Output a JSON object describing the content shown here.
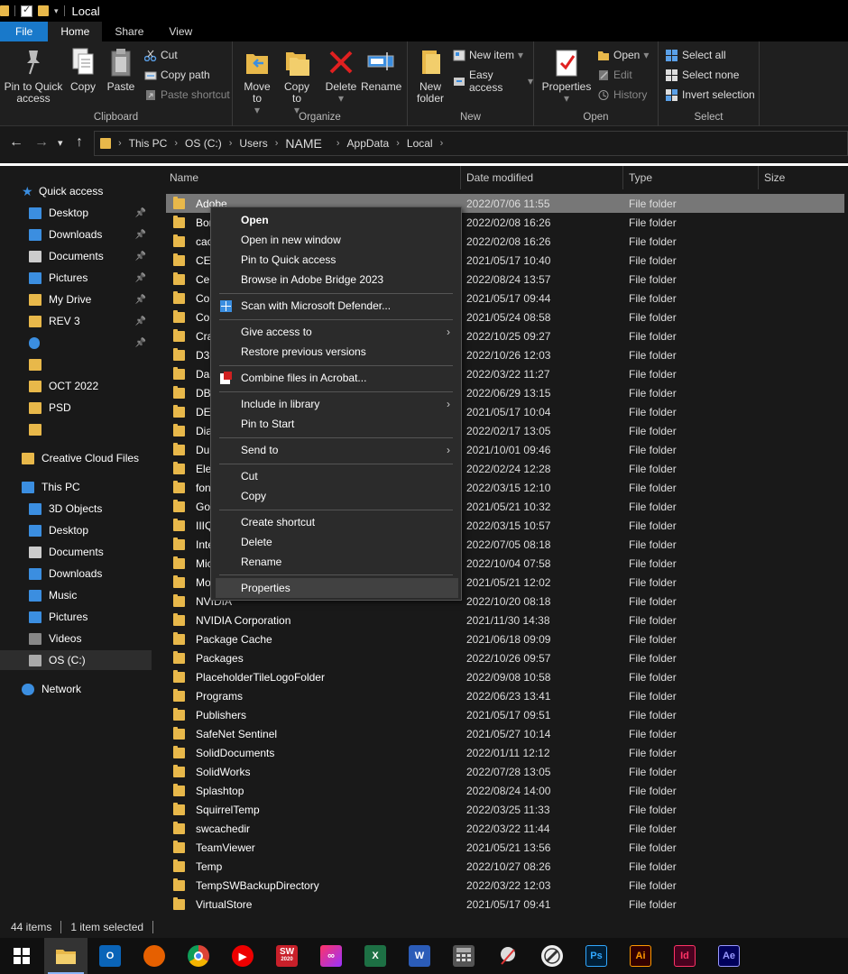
{
  "window": {
    "title": "Local"
  },
  "ribbon": {
    "tabs": [
      "File",
      "Home",
      "Share",
      "View"
    ],
    "clipboard": {
      "label": "Clipboard",
      "pin": "Pin to Quick access",
      "copy": "Copy",
      "paste": "Paste",
      "cut": "Cut",
      "copy_path": "Copy path",
      "paste_shortcut": "Paste shortcut"
    },
    "organize": {
      "label": "Organize",
      "move_to": "Move to",
      "copy_to": "Copy to",
      "delete": "Delete",
      "rename": "Rename"
    },
    "new": {
      "label": "New",
      "new_folder": "New folder",
      "new_item": "New item",
      "easy_access": "Easy access"
    },
    "open": {
      "label": "Open",
      "properties": "Properties",
      "open": "Open",
      "edit": "Edit",
      "history": "History"
    },
    "select": {
      "label": "Select",
      "select_all": "Select all",
      "select_none": "Select none",
      "invert": "Invert selection"
    }
  },
  "address": {
    "crumbs": [
      "This PC",
      "OS (C:)",
      "Users",
      "NAME",
      "AppData",
      "Local"
    ]
  },
  "nav": {
    "quick_access": "Quick access",
    "qa_items": [
      "Desktop",
      "Downloads",
      "Documents",
      "Pictures",
      "My Drive",
      "REV 3",
      "",
      "",
      "OCT 2022",
      "PSD",
      ""
    ],
    "creative_cloud": "Creative Cloud Files",
    "this_pc": "This PC",
    "pc_items": [
      "3D Objects",
      "Desktop",
      "Documents",
      "Downloads",
      "Music",
      "Pictures",
      "Videos",
      "OS (C:)"
    ],
    "network": "Network"
  },
  "columns": {
    "name": "Name",
    "date": "Date modified",
    "type": "Type",
    "size": "Size"
  },
  "files": [
    {
      "name": "Adobe",
      "date": "2022/07/06 11:55",
      "type": "File folder"
    },
    {
      "name": "Boris",
      "date": "2022/02/08 16:26",
      "type": "File folder"
    },
    {
      "name": "cach",
      "date": "2022/02/08 16:26",
      "type": "File folder"
    },
    {
      "name": "CEF",
      "date": "2021/05/17 10:40",
      "type": "File folder"
    },
    {
      "name": "Cent",
      "date": "2022/08/24 13:57",
      "type": "File folder"
    },
    {
      "name": "Com",
      "date": "2021/05/17 09:44",
      "type": "File folder"
    },
    {
      "name": "Con",
      "date": "2021/05/24 08:58",
      "type": "File folder"
    },
    {
      "name": "Cras",
      "date": "2022/10/25 09:27",
      "type": "File folder"
    },
    {
      "name": "D3D",
      "date": "2022/10/26 12:03",
      "type": "File folder"
    },
    {
      "name": "Dass",
      "date": "2022/03/22 11:27",
      "type": "File folder"
    },
    {
      "name": "DBG",
      "date": "2022/06/29 13:15",
      "type": "File folder"
    },
    {
      "name": "DELL",
      "date": "2021/05/17 10:04",
      "type": "File folder"
    },
    {
      "name": "Diag",
      "date": "2022/02/17 13:05",
      "type": "File folder"
    },
    {
      "name": "Dup",
      "date": "2021/10/01 09:46",
      "type": "File folder"
    },
    {
      "name": "Eleva",
      "date": "2022/02/24 12:28",
      "type": "File folder"
    },
    {
      "name": "font",
      "date": "2022/03/15 12:10",
      "type": "File folder"
    },
    {
      "name": "Goo",
      "date": "2021/05/21 10:32",
      "type": "File folder"
    },
    {
      "name": "IIIQF",
      "date": "2022/03/15 10:57",
      "type": "File folder"
    },
    {
      "name": "Intel",
      "date": "2022/07/05 08:18",
      "type": "File folder"
    },
    {
      "name": "Micr",
      "date": "2022/10/04 07:58",
      "type": "File folder"
    },
    {
      "name": "Moz",
      "date": "2021/05/21 12:02",
      "type": "File folder"
    },
    {
      "name": "NVIDIA",
      "date": "2022/10/20 08:18",
      "type": "File folder"
    },
    {
      "name": "NVIDIA Corporation",
      "date": "2021/11/30 14:38",
      "type": "File folder"
    },
    {
      "name": "Package Cache",
      "date": "2021/06/18 09:09",
      "type": "File folder"
    },
    {
      "name": "Packages",
      "date": "2022/10/26 09:57",
      "type": "File folder"
    },
    {
      "name": "PlaceholderTileLogoFolder",
      "date": "2022/09/08 10:58",
      "type": "File folder"
    },
    {
      "name": "Programs",
      "date": "2022/06/23 13:41",
      "type": "File folder"
    },
    {
      "name": "Publishers",
      "date": "2021/05/17 09:51",
      "type": "File folder"
    },
    {
      "name": "SafeNet Sentinel",
      "date": "2021/05/27 10:14",
      "type": "File folder"
    },
    {
      "name": "SolidDocuments",
      "date": "2022/01/11 12:12",
      "type": "File folder"
    },
    {
      "name": "SolidWorks",
      "date": "2022/07/28 13:05",
      "type": "File folder"
    },
    {
      "name": "Splashtop",
      "date": "2022/08/24 14:00",
      "type": "File folder"
    },
    {
      "name": "SquirrelTemp",
      "date": "2022/03/25 11:33",
      "type": "File folder"
    },
    {
      "name": "swcachedir",
      "date": "2022/03/22 11:44",
      "type": "File folder"
    },
    {
      "name": "TeamViewer",
      "date": "2021/05/21 13:56",
      "type": "File folder"
    },
    {
      "name": "Temp",
      "date": "2022/10/27 08:26",
      "type": "File folder"
    },
    {
      "name": "TempSWBackupDirectory",
      "date": "2022/03/22 12:03",
      "type": "File folder"
    },
    {
      "name": "VirtualStore",
      "date": "2021/05/17 09:41",
      "type": "File folder"
    }
  ],
  "context_menu": {
    "items": [
      "Open",
      "Open in new window",
      "Pin to Quick access",
      "Browse in Adobe Bridge 2023",
      "Scan with Microsoft Defender...",
      "Give access to",
      "Restore previous versions",
      "Combine files in Acrobat...",
      "Include in library",
      "Pin to Start",
      "Send to",
      "Cut",
      "Copy",
      "Create shortcut",
      "Delete",
      "Rename",
      "Properties"
    ]
  },
  "status": {
    "count": "44 items",
    "selected": "1 item selected"
  },
  "taskbar": {
    "icons": [
      "windows-start",
      "file-explorer",
      "outlook",
      "firefox",
      "chrome",
      "youtube-music",
      "solidworks-2020",
      "creative-cloud",
      "excel",
      "word",
      "calculator",
      "snipping-tool",
      "inkscape-pen",
      "photoshop",
      "illustrator",
      "indesign",
      "after-effects"
    ],
    "labels": {
      "ps": "Ps",
      "ai": "Ai",
      "id": "Id",
      "ae": "Ae",
      "sw": "SW",
      "sw_year": "2020",
      "xl": "X",
      "wd": "W",
      "ol": "O"
    }
  },
  "colors": {
    "accent": "#1979ca",
    "folder": "#e8b84a",
    "background": "#191919",
    "selected_row": "#777777"
  }
}
